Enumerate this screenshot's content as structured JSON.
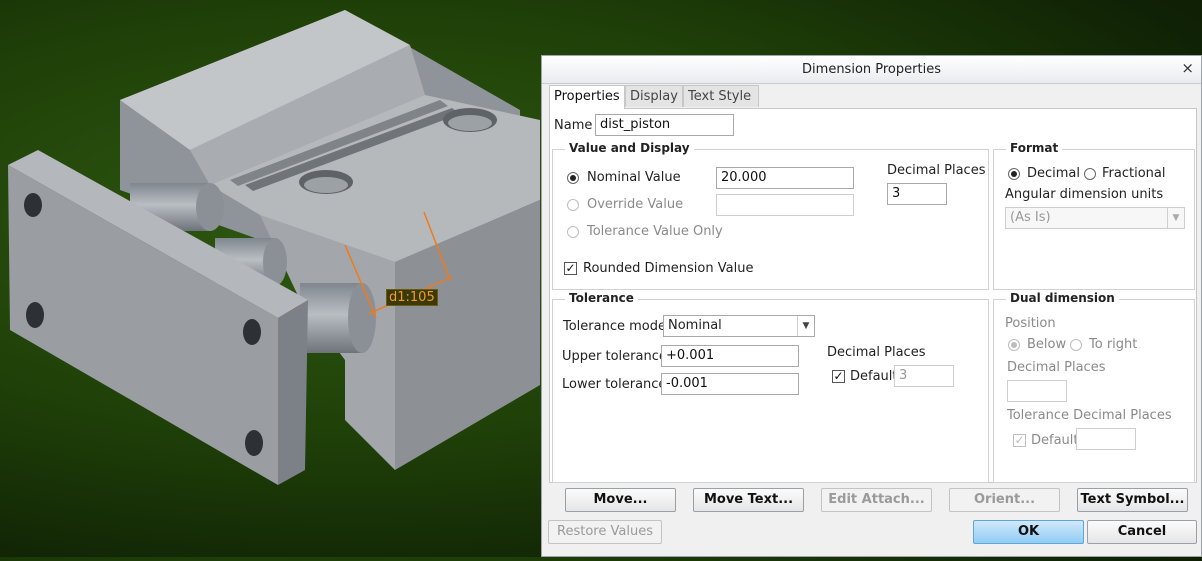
{
  "viewport": {
    "dimension_label": "d1:105"
  },
  "dialog": {
    "title": "Dimension Properties",
    "close_glyph": "×",
    "tabs": [
      "Properties",
      "Display",
      "Text Style"
    ],
    "name_label": "Name",
    "name_value": "dist_piston",
    "value_display": {
      "title": "Value and Display",
      "nominal_label": "Nominal Value",
      "nominal_value": "20.000",
      "override_label": "Override Value",
      "override_value": "",
      "tolerance_only_label": "Tolerance Value Only",
      "rounded_label": "Rounded Dimension Value",
      "rounded_checked": true,
      "decimal_places_label": "Decimal Places",
      "decimal_places_value": "3"
    },
    "format": {
      "title": "Format",
      "decimal_label": "Decimal",
      "fractional_label": "Fractional",
      "angular_label": "Angular dimension units",
      "angular_value": "(As Is)"
    },
    "tolerance": {
      "title": "Tolerance",
      "mode_label": "Tolerance mode",
      "mode_value": "Nominal",
      "upper_label": "Upper tolerance",
      "upper_value": "+0.001",
      "lower_label": "Lower tolerance",
      "lower_value": "-0.001",
      "decimal_places_label": "Decimal Places",
      "default_label": "Default",
      "default_value": "3"
    },
    "dual": {
      "title": "Dual dimension",
      "position_label": "Position",
      "below_label": "Below",
      "right_label": "To right",
      "decimal_places_label": "Decimal Places",
      "decimal_places_value": "",
      "tol_decimal_label": "Tolerance Decimal Places",
      "default_label": "Default",
      "default_value": ""
    },
    "buttons": {
      "move": "Move...",
      "move_text": "Move Text...",
      "edit_attach": "Edit Attach...",
      "orient": "Orient...",
      "text_symbol": "Text Symbol...",
      "restore": "Restore Values",
      "ok": "OK",
      "cancel": "Cancel"
    }
  }
}
